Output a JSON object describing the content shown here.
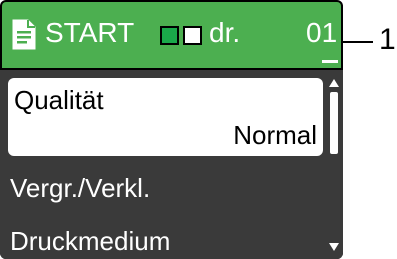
{
  "header": {
    "mode_label": "START",
    "copies_unit": "dr.",
    "copies_value": "01",
    "icon": "document-icon"
  },
  "menu": {
    "selected_item": {
      "label": "Qualität",
      "value": "Normal"
    },
    "items": [
      {
        "label": "Vergr./Verkl."
      },
      {
        "label": "Druckmedium"
      }
    ]
  },
  "callout": {
    "label": "1"
  },
  "colors": {
    "header_bg": "#4caf50",
    "menu_bg": "#3a3a3a",
    "bw_indicator": "#1aa84a"
  }
}
